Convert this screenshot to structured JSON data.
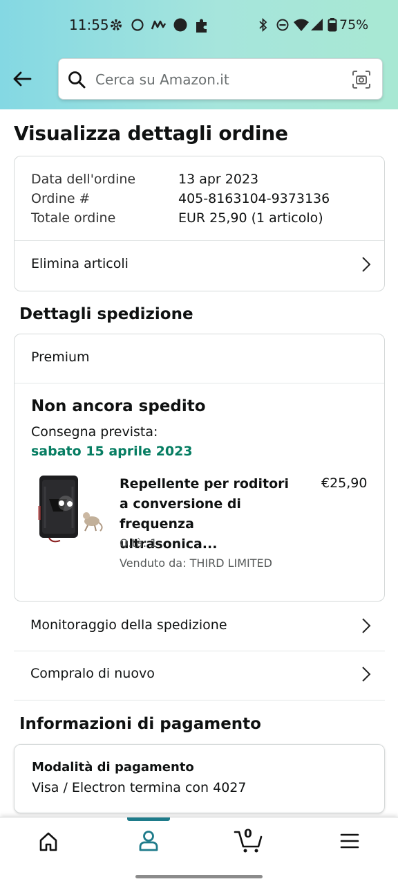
{
  "status_bar": {
    "time": "11:55",
    "battery": "75%"
  },
  "search": {
    "placeholder": "Cerca su Amazon.it"
  },
  "page": {
    "title": "Visualizza dettagli ordine"
  },
  "order_summary": {
    "rows": [
      {
        "label": "Data dell'ordine",
        "value": "13 apr 2023"
      },
      {
        "label": "Ordine #",
        "value": "405-8163104-9373136"
      },
      {
        "label": "Totale ordine",
        "value": "EUR 25,90 (1 articolo)"
      }
    ],
    "delete_items": "Elimina articoli"
  },
  "shipping": {
    "section_title": "Dettagli spedizione",
    "tier": "Premium",
    "status": "Non ancora spedito",
    "eta_label": "Consegna prevista:",
    "eta_date": "sabato 15 aprile 2023",
    "item": {
      "title": "Repellente per roditori a conversione di frequenza ultrasonica...",
      "price": "€25,90",
      "qty": "Q.tà: 1",
      "seller": "Venduto da: THIRD LIMITED"
    },
    "track": "Monitoraggio della spedizione",
    "buy_again": "Compralo di nuovo"
  },
  "payment": {
    "section_title": "Informazioni di pagamento",
    "method_title": "Modalità di pagamento",
    "method": "Visa / Electron  termina con 4027"
  },
  "bottom_nav": {
    "cart_count": "0",
    "active": "account",
    "accent": "#1e7b8a"
  },
  "colors": {
    "header_start": "#84d8e3",
    "header_end": "#a8e8d3",
    "delivery_green": "#067d62"
  }
}
